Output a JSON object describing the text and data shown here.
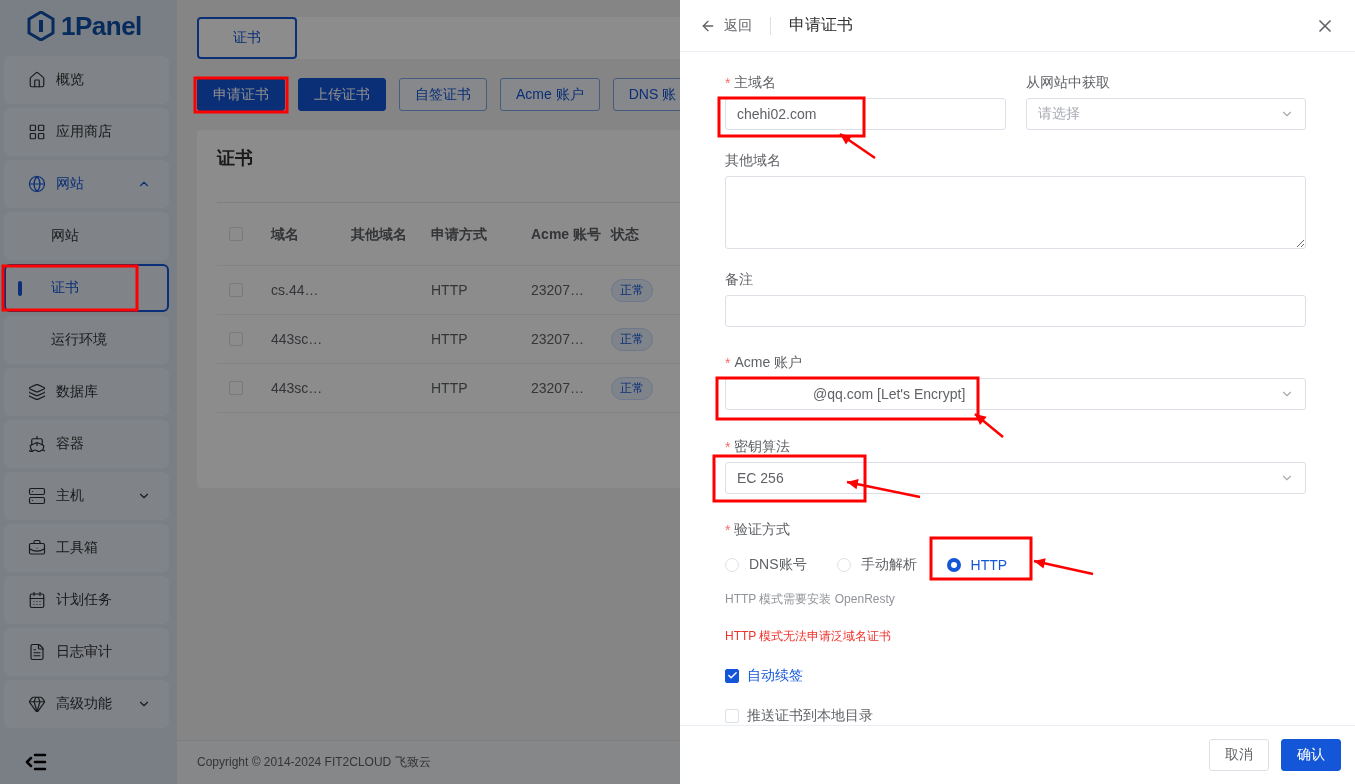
{
  "logo": {
    "text": "1Panel"
  },
  "sidebar": {
    "items": [
      {
        "label": "概览",
        "selected": false
      },
      {
        "label": "应用商店",
        "selected": false
      },
      {
        "label": "网站",
        "selected": false,
        "expanded": true,
        "children": [
          {
            "label": "网站",
            "selected": false
          },
          {
            "label": "证书",
            "selected": true
          },
          {
            "label": "运行环境",
            "selected": false
          }
        ]
      },
      {
        "label": "数据库",
        "selected": false
      },
      {
        "label": "容器",
        "selected": false
      },
      {
        "label": "主机",
        "selected": false,
        "expanded": false
      },
      {
        "label": "工具箱",
        "selected": false
      },
      {
        "label": "计划任务",
        "selected": false
      },
      {
        "label": "日志审计",
        "selected": false
      },
      {
        "label": "高级功能",
        "selected": false,
        "expanded": false
      }
    ]
  },
  "tabs": [
    {
      "label": "证书",
      "selected": true
    }
  ],
  "toolbar": [
    {
      "label": "申请证书",
      "kind": "primary"
    },
    {
      "label": "上传证书",
      "kind": "primary"
    },
    {
      "label": "自签证书",
      "kind": "outline"
    },
    {
      "label": "Acme 账户",
      "kind": "outline"
    },
    {
      "label": "DNS 账",
      "kind": "outline"
    }
  ],
  "card": {
    "title": "证书",
    "table": {
      "all_checked": false,
      "columns": [
        "域名",
        "其他域名",
        "申请方式",
        "Acme 账号",
        "状态"
      ],
      "rows": [
        {
          "checked": false,
          "domain": "cs.44…",
          "method": "HTTP",
          "acme": "23207…",
          "status": "正常"
        },
        {
          "checked": false,
          "domain": "443sc…",
          "method": "HTTP",
          "acme": "23207…",
          "status": "正常"
        },
        {
          "checked": false,
          "domain": "443sc…",
          "method": "HTTP",
          "acme": "23207…",
          "status": "正常"
        }
      ]
    }
  },
  "footer": {
    "copyright": "Copyright © 2014-2024 FIT2CLOUD 飞致云"
  },
  "drawer": {
    "back": "返回",
    "title": "申请证书",
    "main_domain": {
      "label": "主域名",
      "required_mark": "*",
      "value": "chehi02.com"
    },
    "from_website": {
      "label": "从网站中获取",
      "placeholder": "请选择"
    },
    "other_domains": {
      "label": "其他域名"
    },
    "remark": {
      "label": "备注"
    },
    "acme_account": {
      "label": "Acme 账户",
      "required_mark": "*",
      "value": "@qq.com [Let's Encrypt]"
    },
    "key_algorithm": {
      "label": "密钥算法",
      "required_mark": "*",
      "value": "EC 256"
    },
    "verify_method": {
      "label": "验证方式",
      "required_mark": "*",
      "options": [
        {
          "label": "DNS账号",
          "selected": false
        },
        {
          "label": "手动解析",
          "selected": false
        },
        {
          "label": "HTTP",
          "selected": true
        }
      ],
      "hint": "HTTP 模式需要安装 OpenResty",
      "warning": "HTTP 模式无法申请泛域名证书"
    },
    "checkboxes": [
      {
        "label": "自动续签",
        "checked": true
      },
      {
        "label": "推送证书到本地目录",
        "checked": false
      }
    ],
    "buttons": [
      {
        "label": "取消",
        "kind": "default"
      },
      {
        "label": "确认",
        "kind": "primary"
      }
    ]
  }
}
